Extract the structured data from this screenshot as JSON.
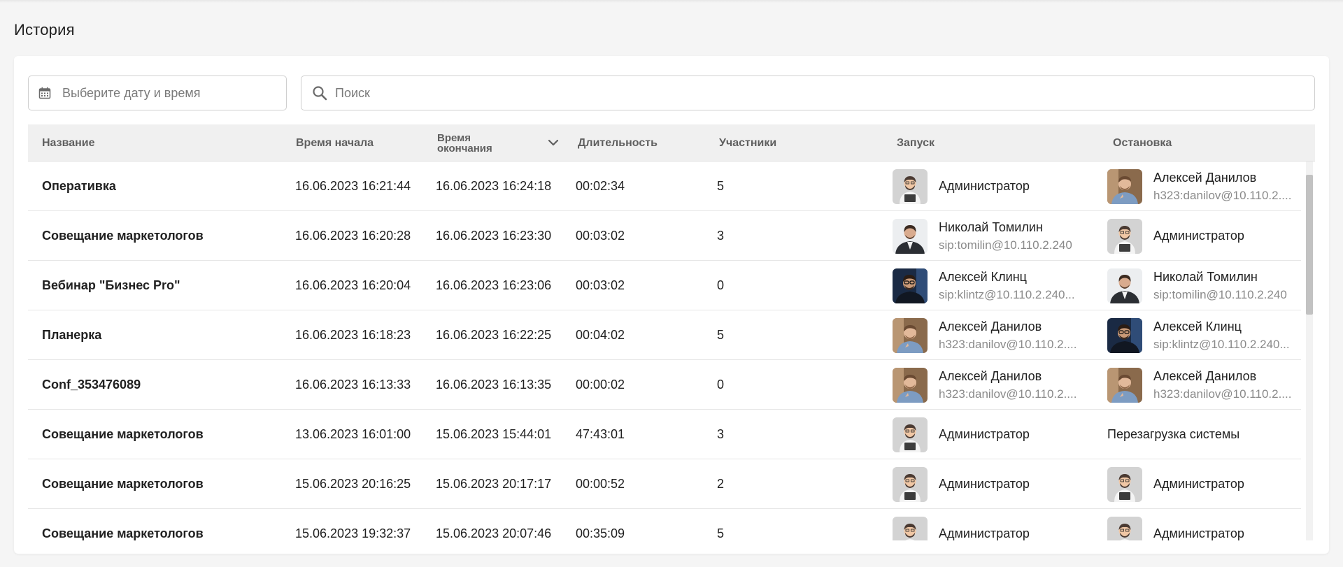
{
  "page": {
    "title": "История"
  },
  "filters": {
    "date_placeholder": "Выберите дату и время",
    "search_placeholder": "Поиск"
  },
  "table": {
    "columns": {
      "name": "Название",
      "start": "Время начала",
      "end_line1": "Время",
      "end_line2": "окончания",
      "duration": "Длительность",
      "participants": "Участники",
      "launch": "Запуск",
      "stop": "Остановка"
    },
    "sort": {
      "column": "end",
      "direction": "desc",
      "icon": "chevron-down-icon"
    },
    "rows": [
      {
        "name": "Оперативка",
        "start": "16.06.2023 16:21:44",
        "end": "16.06.2023 16:24:18",
        "duration": "00:02:34",
        "participants": "5",
        "launch": {
          "avatar": "admin",
          "name": "Администратор",
          "sub": ""
        },
        "stop": {
          "avatar": "danilov",
          "name": "Алексей Данилов",
          "sub": "h323:danilov@10.110.2...."
        }
      },
      {
        "name": "Совещание маркетологов",
        "start": "16.06.2023 16:20:28",
        "end": "16.06.2023 16:23:30",
        "duration": "00:03:02",
        "participants": "3",
        "launch": {
          "avatar": "tomilin",
          "name": "Николай Томилин",
          "sub": "sip:tomilin@10.110.2.240"
        },
        "stop": {
          "avatar": "admin",
          "name": "Администратор",
          "sub": ""
        }
      },
      {
        "name": "Вебинар \"Бизнес Pro\"",
        "start": "16.06.2023 16:20:04",
        "end": "16.06.2023 16:23:06",
        "duration": "00:03:02",
        "participants": "0",
        "launch": {
          "avatar": "klintz",
          "name": "Алексей Клинц",
          "sub": "sip:klintz@10.110.2.240..."
        },
        "stop": {
          "avatar": "tomilin",
          "name": "Николай Томилин",
          "sub": "sip:tomilin@10.110.2.240"
        }
      },
      {
        "name": "Планерка",
        "start": "16.06.2023 16:18:23",
        "end": "16.06.2023 16:22:25",
        "duration": "00:04:02",
        "participants": "5",
        "launch": {
          "avatar": "danilov",
          "name": "Алексей Данилов",
          "sub": "h323:danilov@10.110.2...."
        },
        "stop": {
          "avatar": "klintz",
          "name": "Алексей Клинц",
          "sub": "sip:klintz@10.110.2.240..."
        }
      },
      {
        "name": "Conf_353476089",
        "start": "16.06.2023 16:13:33",
        "end": "16.06.2023 16:13:35",
        "duration": "00:00:02",
        "participants": "0",
        "launch": {
          "avatar": "danilov",
          "name": "Алексей Данилов",
          "sub": "h323:danilov@10.110.2...."
        },
        "stop": {
          "avatar": "danilov",
          "name": "Алексей Данилов",
          "sub": "h323:danilov@10.110.2...."
        }
      },
      {
        "name": "Совещание маркетологов",
        "start": "13.06.2023 16:01:00",
        "end": "15.06.2023 15:44:01",
        "duration": "47:43:01",
        "participants": "3",
        "launch": {
          "avatar": "admin",
          "name": "Администратор",
          "sub": ""
        },
        "stop": {
          "avatar": "",
          "name": "Перезагрузка системы",
          "sub": ""
        }
      },
      {
        "name": "Совещание маркетологов",
        "start": "15.06.2023 20:16:25",
        "end": "15.06.2023 20:17:17",
        "duration": "00:00:52",
        "participants": "2",
        "launch": {
          "avatar": "admin",
          "name": "Администратор",
          "sub": ""
        },
        "stop": {
          "avatar": "admin",
          "name": "Администратор",
          "sub": ""
        }
      },
      {
        "name": "Совещание маркетологов",
        "start": "15.06.2023 19:32:37",
        "end": "15.06.2023 20:07:46",
        "duration": "00:35:09",
        "participants": "5",
        "launch": {
          "avatar": "admin",
          "name": "Администратор",
          "sub": ""
        },
        "stop": {
          "avatar": "admin",
          "name": "Администратор",
          "sub": ""
        }
      }
    ]
  },
  "colors": {
    "background": "#f5f5f5",
    "card": "#ffffff",
    "header": "#f0f0f0",
    "border": "#cfcfcf",
    "muted_text": "#8a8a8a"
  }
}
